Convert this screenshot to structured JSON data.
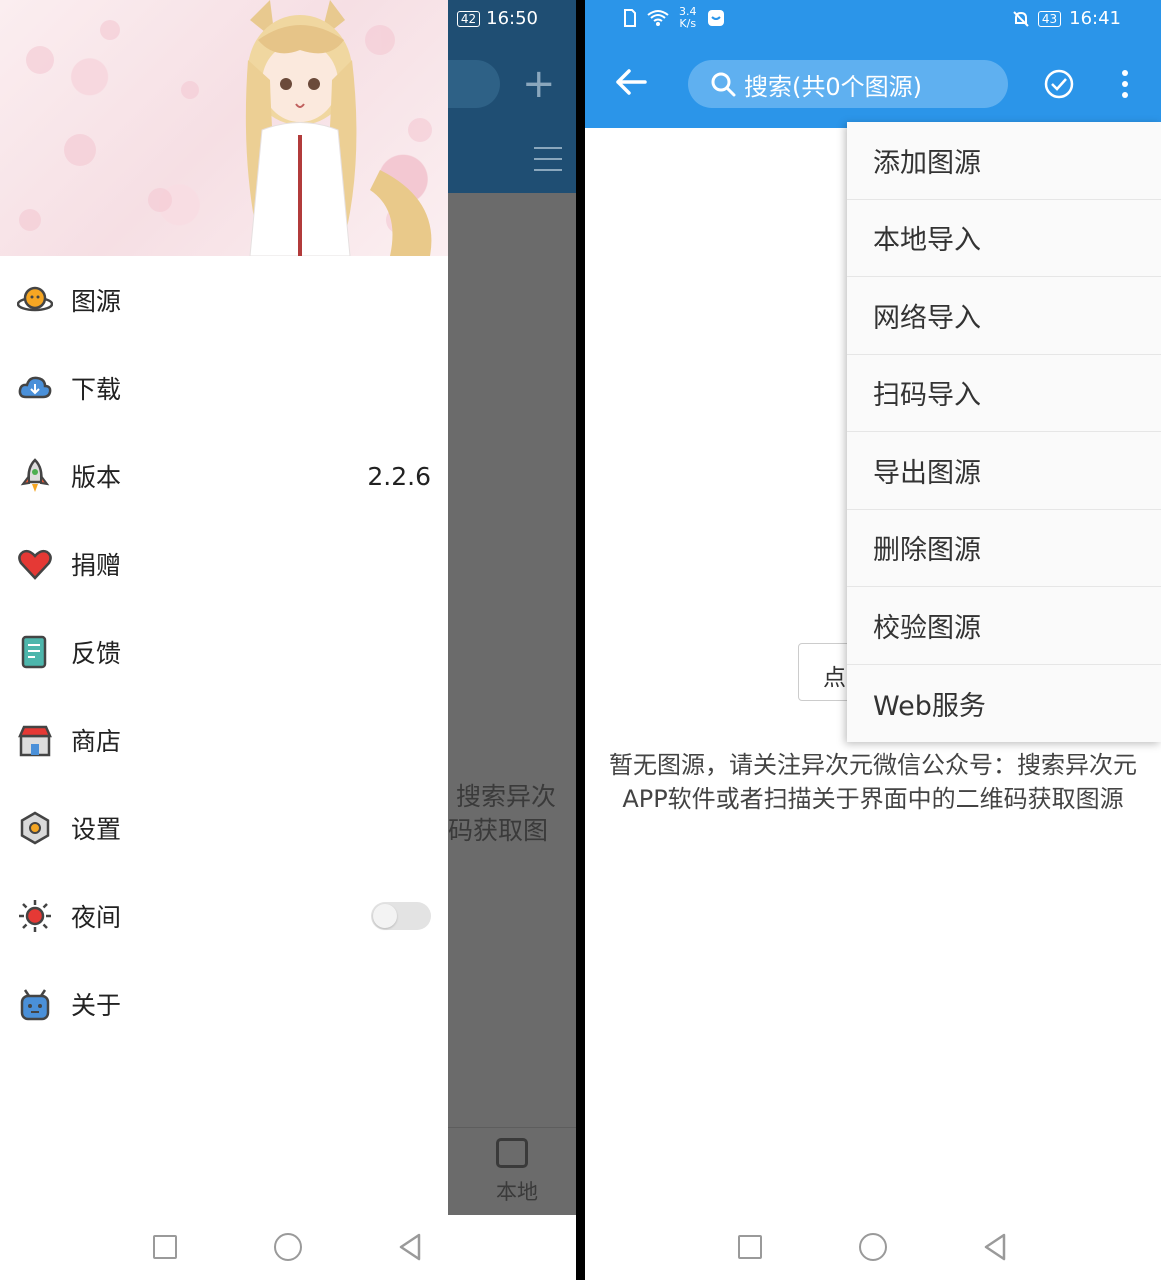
{
  "left": {
    "status": {
      "battery": "42",
      "time": "16:50"
    },
    "background": {
      "empty_line1": "搜索异次",
      "empty_line2": "码获取图",
      "bottom_nav_label": "本地"
    },
    "drawer": {
      "items": [
        {
          "label": "图源",
          "icon": "planet-icon"
        },
        {
          "label": "下载",
          "icon": "cloud-icon"
        },
        {
          "label": "版本",
          "icon": "rocket-icon",
          "value": "2.2.6"
        },
        {
          "label": "捐赠",
          "icon": "heart-icon"
        },
        {
          "label": "反馈",
          "icon": "document-icon"
        },
        {
          "label": "商店",
          "icon": "store-icon"
        },
        {
          "label": "设置",
          "icon": "gear-icon"
        },
        {
          "label": "夜间",
          "icon": "sun-icon",
          "toggle": false
        },
        {
          "label": "关于",
          "icon": "robot-icon"
        }
      ]
    }
  },
  "right": {
    "status": {
      "speed_top": "3.4",
      "speed_bottom": "K/s",
      "battery": "43",
      "time": "16:41"
    },
    "appbar": {
      "search_placeholder": "搜索(共0个图源)"
    },
    "input_partial": "点",
    "empty_message": "暂无图源，请关注异次元微信公众号：搜索异次元APP软件或者扫描关于界面中的二维码获取图源",
    "menu": [
      "添加图源",
      "本地导入",
      "网络导入",
      "扫码导入",
      "导出图源",
      "删除图源",
      "校验图源",
      "Web服务"
    ]
  },
  "colors": {
    "appbar_blue": "#2b95e9",
    "dark_topbar": "#1f4e73",
    "scrim": "#6b6b6b"
  }
}
